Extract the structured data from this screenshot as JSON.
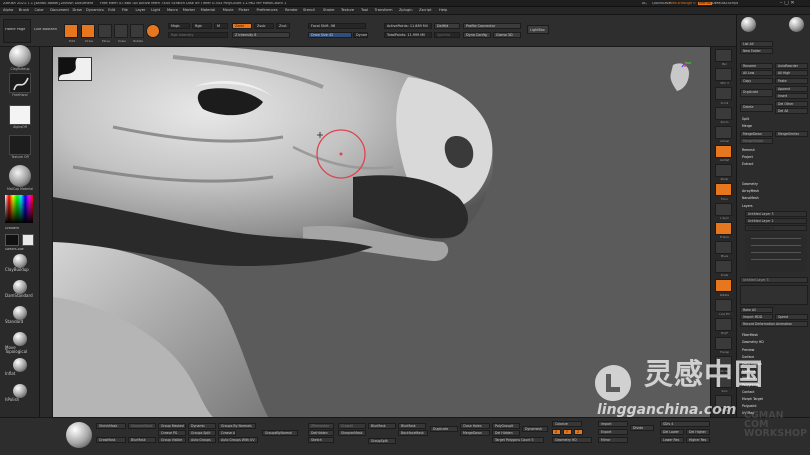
{
  "titlebar": {
    "app": "ZBrush 2021.7.1 [sandu dowel]  ZBrush Document",
    "stats": "Free Mem 47.680 GB  Active Mem 7445  Scratch Disk 49  Timer 0.543  PolyCount 11.962 MP  MeshCount 1",
    "ac": "AC",
    "quicksave": "QuickSave",
    "see_through": "See-through 0",
    "menus_btn": "Menus",
    "default_script": "DefaultZScript"
  },
  "menus": [
    "Alpha",
    "Brush",
    "Color",
    "Document",
    "Draw",
    "Dynamics",
    "Edit",
    "File",
    "Layer",
    "Light",
    "Macro",
    "Marker",
    "Material",
    "Movie",
    "Picker",
    "Preferences",
    "Render",
    "Stencil",
    "Stroke",
    "Texture",
    "Tool",
    "Transform",
    "Zplugin",
    "Zscript",
    "Help"
  ],
  "shelf": {
    "home_page": "Home Page",
    "lightbox": "Live Boolean",
    "edit": "Edit",
    "draw": "Draw",
    "move": "Move",
    "scale": "Scale",
    "rotate": "Rotate",
    "mrgb": "Mrgb",
    "rgb": "Rgb",
    "m": "M",
    "rgb_intensity": "Rgb Intensity",
    "zadd": "Zadd",
    "zsub": "Zsub",
    "zcut": "Zcut",
    "z_intensity": "Z Intensity 8",
    "focal_shift": "Focal Shift -96",
    "draw_size": "Draw Size 42",
    "dynamic": "Dynamic",
    "active_points": "ActivePoints: 11.889 Mil",
    "total_points": "TotalPoints: 11.999 Mil",
    "del_hidden": "DelHid",
    "split_hidden": "SplitHid",
    "double": "Double",
    "profile_connector": "Profile Connector",
    "dyna_config": "Dyna Config",
    "gizmo": "Gizmo 3D",
    "lightbox_btn": "LightBox"
  },
  "lefttray": {
    "brush1": "ClayBuildup",
    "brush2": "FreeHand",
    "brush3": "AlphaOff",
    "texture": "Texture Off",
    "material": "MatCap Material",
    "gradient": "Gradient",
    "switch": "SwitchColor",
    "brushes": [
      "ClayBuildup",
      "DamStandard",
      "Standard",
      "Move Topological",
      "Inflat",
      "hPolish"
    ]
  },
  "rightshelf": [
    "Bpr",
    "SPix 3",
    "Scroll",
    "Zoom",
    "Actual",
    "AAHalf",
    "Persp",
    "Floor",
    "L.Sym",
    "Frame",
    "Move",
    "Scale",
    "Rotate",
    "Line Fill",
    "PolyF",
    "Transp",
    "Ghost",
    "Solo",
    "Xpose"
  ],
  "righttray": {
    "list_all": "List All",
    "new_folder": "New Folder",
    "rename": "Rename",
    "auto_reorder": "AutoReorder",
    "all_low": "All Low",
    "all_high": "All High",
    "copy": "Copy",
    "paste": "Paste",
    "duplicate": "Duplicate",
    "append": "Append",
    "insert": "Insert",
    "delete": "Delete",
    "del_other": "Del Other",
    "del_all": "Del All",
    "split": "Split",
    "merge": "Merge",
    "merge_down": "MergeDown",
    "merge_similar": "MergeSimilar",
    "merge_visible": "MergeVisible",
    "remesh": "Remesh",
    "project": "Project",
    "extract": "Extract",
    "geometry": "Geometry",
    "array_mesh": "ArrayMesh",
    "nano_mesh": "NanoMesh",
    "layers": "Layers",
    "layer1": "Untitled Layer 3",
    "layer2": "Untitled Layer 2",
    "layer3": "Untitled Layer 1",
    "bake_all": "Bake All",
    "import_mdd": "Import MDD",
    "speed": "Speed",
    "record": "Record Deformation Animation",
    "fibermesh": "FiberMesh",
    "geometry_hd": "Geometry HD",
    "preview": "Preview",
    "surface": "Surface",
    "deformation": "Deformation",
    "masking": "Masking",
    "visibility": "Visibility",
    "polygroups": "Polygroups",
    "contact": "Contact",
    "morph_target": "Morph Target",
    "polypaint": "Polypaint",
    "uv_map": "UV Map",
    "texture_map": "Texture Map",
    "displacement_map": "Displacement Map",
    "normal_map": "Normal Map",
    "vector_disp_map": "Vector Displacement Map"
  },
  "bottom": {
    "shrink_mask": "ShrinkMask",
    "sharpen_mask": "SharpenMask",
    "grow_mask": "GrowMask",
    "blur_mask": "BlurMask",
    "group_masked": "Group Masked",
    "crease_pg": "Crease PG",
    "group_visible": "Group Visible",
    "dynamic": "Dynamic",
    "groups_split": "Groups Split",
    "auto_groups": "Auto Groups",
    "groups_by_normals": "Groups By Normals",
    "crease_all": "Crease All",
    "auto_groups_uv": "Auto Groups With UV",
    "group_by_normals2": "GroupsByNormal",
    "zremesher": "ZRemesher",
    "del_hidden": "DelHidden",
    "sketch": "Sketch",
    "sharpen_mask2": "SharpenMask",
    "grow_all": "GrowAll",
    "blur_mask2": "BlurMask",
    "group_split2": "GroupSplit",
    "backface_mask": "BackfaceMask",
    "duplicate": "Duplicate",
    "close_holes": "Close Holes",
    "merge_down": "MergeDown",
    "del_hidden2": "Del Hidden",
    "polygroupit": "PolyGroupIt",
    "group_visible2": "GroupVisible",
    "dynamesh": "Dynamesh",
    "target_polygons": "Target Polygons Count 5",
    "geometry_hd": "Geometry HD",
    "colorize": "Colorize",
    "export": "Export",
    "import": "Import",
    "mirror": "Mirror",
    "divide": "Divide",
    "sdiv": "SDiv 4",
    "del_lower": "Del Lower",
    "del_higher": "Del Higher",
    "lower_res": "Lower Res",
    "higher_res": "Higher Res",
    "btn_x": "X",
    "btn_y": "Y",
    "btn_z": "Z"
  },
  "watermark": {
    "cn": "灵感中国",
    "url": "lingganchina.com",
    "uploader": "CGMAN\nCOM\nWORKSHOP"
  },
  "colors": {
    "accent": "#e6771f",
    "viewport_bg": "#5b5b5b",
    "brush_ring": "#e0424e"
  }
}
